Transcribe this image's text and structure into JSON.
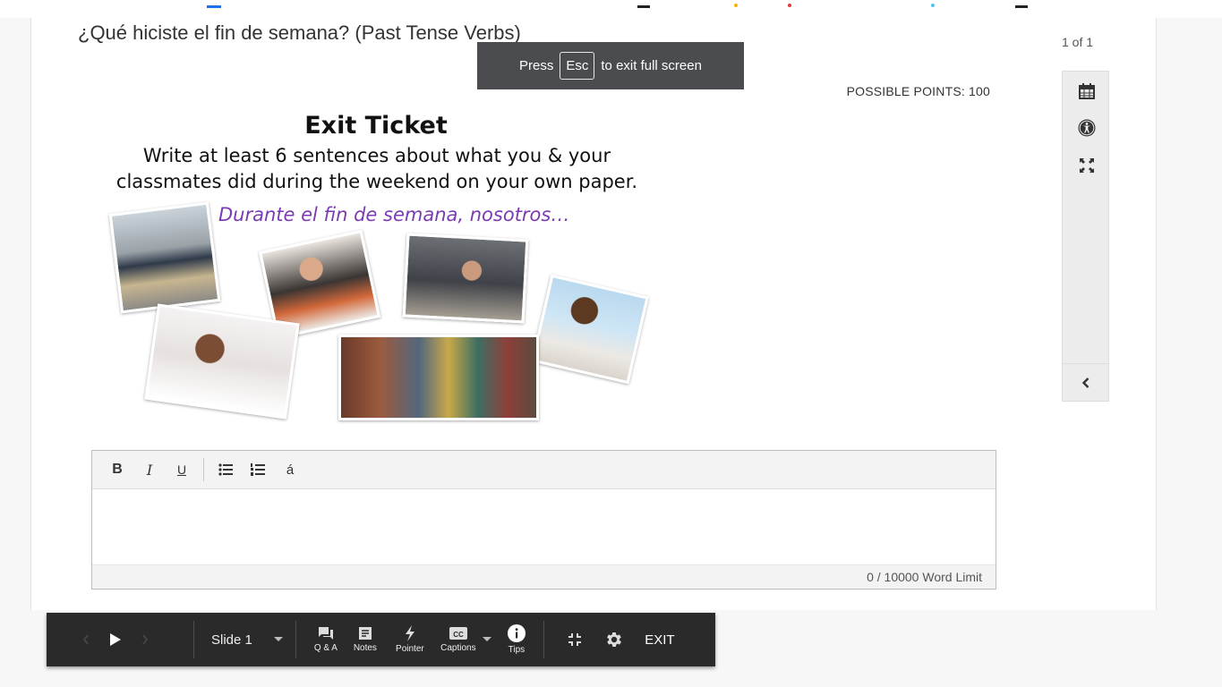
{
  "question": {
    "title": "¿Qué hiciste el fin de semana? (Past Tense Verbs)",
    "points": "POSSIBLE POINTS: 100"
  },
  "fullscreen_toast": {
    "before": "Press",
    "key": "Esc",
    "after": "to exit full screen"
  },
  "image": {
    "title": "Exit Ticket",
    "instruction_line1": "Write at least 6 sentences about what you & your",
    "instruction_line2": "classmates did during the weekend on your own paper.",
    "prompt": "Durante el fin de semana, nosotros…"
  },
  "editor": {
    "toolbar": {
      "bold": "B",
      "italic": "I",
      "underline": "U",
      "accent": "á"
    },
    "word_limit": "0 / 10000 Word Limit"
  },
  "side": {
    "count": "1 of 1"
  },
  "player": {
    "slide": "Slide 1",
    "qa": "Q & A",
    "notes": "Notes",
    "pointer": "Pointer",
    "captions": "Captions",
    "tips": "Tips",
    "exit": "EXIT"
  },
  "colors": {
    "prompt_purple": "#7b3bb0",
    "toolbar_dark": "#2a2a2a",
    "toast_bg": "#4a4c50"
  }
}
